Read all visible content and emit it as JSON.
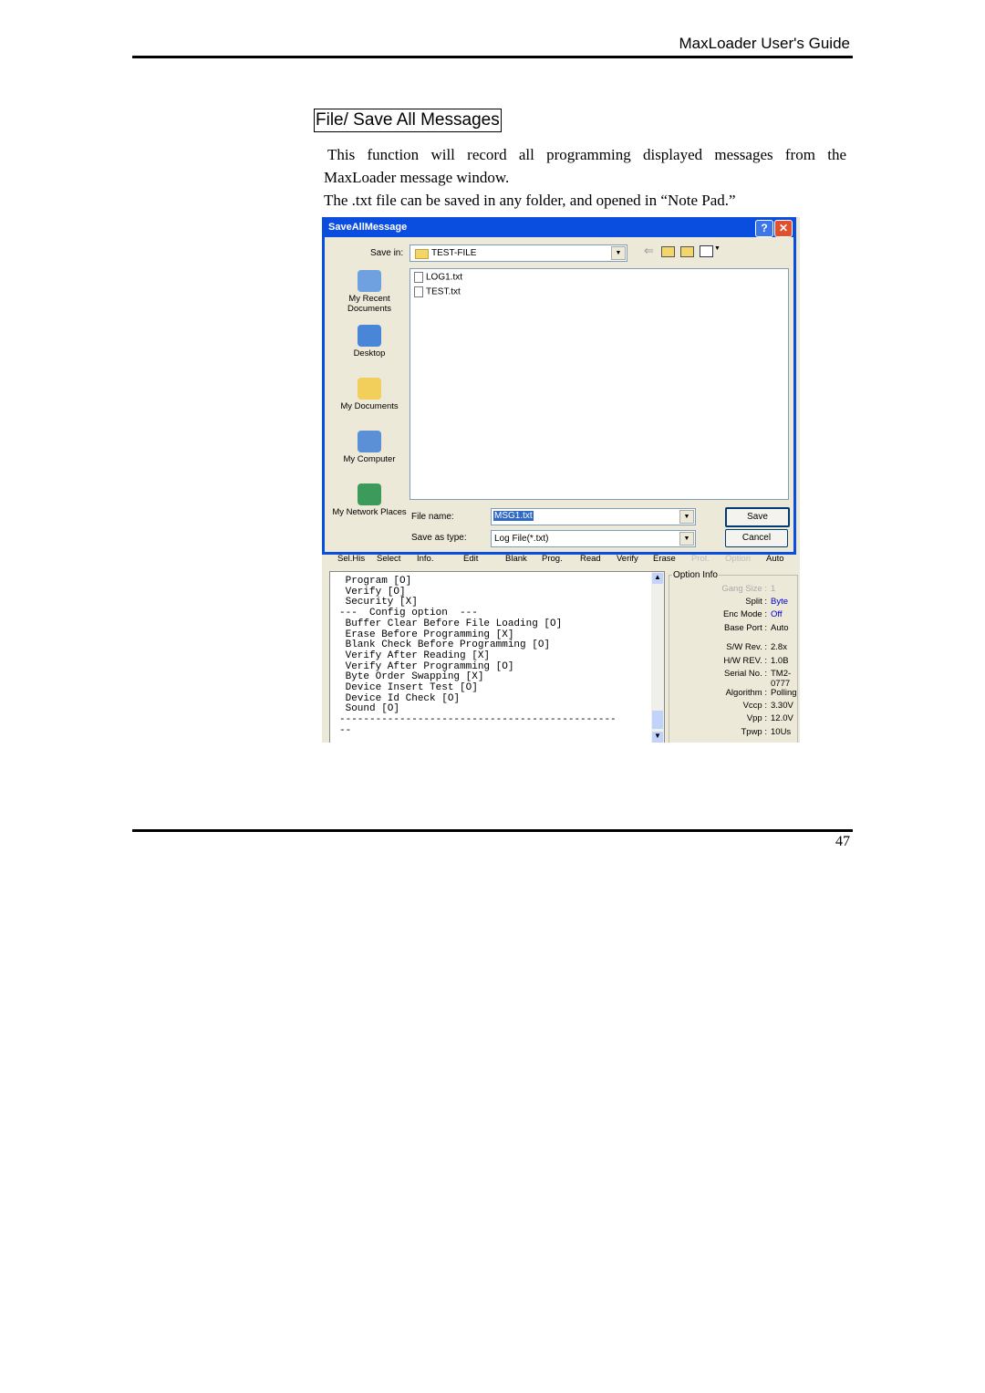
{
  "header": {
    "title": "MaxLoader User's Guide"
  },
  "section": {
    "heading": "File/ Save All Messages",
    "para1_line1": "This function will record all programming displayed messages from the",
    "para1_line2": "MaxLoader message window.",
    "para2": "The .txt file can be saved in any folder, and opened in “Note Pad.”"
  },
  "dialog": {
    "title": "SaveAllMessage",
    "help": "?",
    "close": "✕",
    "save_in_label": "Save in:",
    "save_in_value": "TEST-FILE",
    "places": [
      "My Recent Documents",
      "Desktop",
      "My Documents",
      "My Computer",
      "My Network Places"
    ],
    "files": [
      "LOG1.txt",
      "TEST.txt"
    ],
    "file_name_label": "File name:",
    "file_name_value": "MSG1.txt",
    "type_label": "Save as type:",
    "type_value": "Log File(*.txt)",
    "save": "Save",
    "cancel": "Cancel"
  },
  "app": {
    "toolbar": [
      "Sel.His",
      "Select",
      "Info.",
      "Edit",
      "Blank",
      "Prog.",
      "Read",
      "Verify",
      "Erase",
      "Prot.",
      "Option",
      "Auto"
    ],
    "messages": " Program [O]\n Verify [O]\n Security [X]\n---  Config option  ---\n Buffer Clear Before File Loading [O]\n Erase Before Programming [X]\n Blank Check Before Programming [O]\n Verify After Reading [X]\n Verify After Programming [O]\n Byte Order Swapping [X]\n Device Insert Test [O]\n Device Id Check [O]\n Sound [O]\n----------------------------------------------\n--",
    "option_info_title": "Option Info",
    "option_info": [
      {
        "label": "Gang Size :",
        "value": "1"
      },
      {
        "label": "Split :",
        "value": "Byte"
      },
      {
        "label": "Enc Mode :",
        "value": "Off"
      },
      {
        "label": "Base Port :",
        "value": "Auto"
      },
      {
        "label": "S/W Rev. :",
        "value": "2.8x"
      },
      {
        "label": "H/W REV. :",
        "value": "1.0B"
      },
      {
        "label": "Serial No. :",
        "value": "TM2-0777"
      },
      {
        "label": "Algorithm :",
        "value": "Polling"
      },
      {
        "label": "Vccp :",
        "value": "3.30V"
      },
      {
        "label": "Vpp :",
        "value": "12.0V"
      },
      {
        "label": "Tpwp :",
        "value": "10Us"
      }
    ]
  },
  "footer": {
    "page_number": "47"
  },
  "colors": {
    "titlebar": "#0a4ee0",
    "dialog_bg": "#ece9d8",
    "highlight": "#316ac5",
    "value_blue": "#0000cc"
  }
}
